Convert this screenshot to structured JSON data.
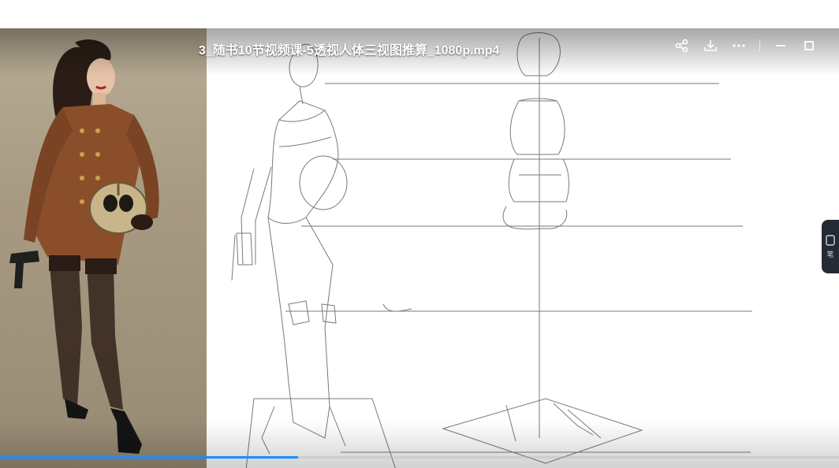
{
  "video": {
    "title": "3_随书10节视频课-5透视人体三视图推算_1080p.mp4",
    "progress": 0.355
  },
  "toolbar": {
    "buttons": [
      {
        "name": "share-icon"
      },
      {
        "name": "download-icon"
      },
      {
        "name": "more-icon"
      },
      {
        "name": "minimize-icon"
      },
      {
        "name": "maximize-icon"
      }
    ]
  },
  "side_tab": {
    "icon": "note-icon",
    "label": "笔"
  },
  "colors": {
    "accent": "#1a8cff",
    "side_tab_bg": "#252a36",
    "jacket": "#8a4f2a",
    "photo_bg": "#a89a82"
  }
}
